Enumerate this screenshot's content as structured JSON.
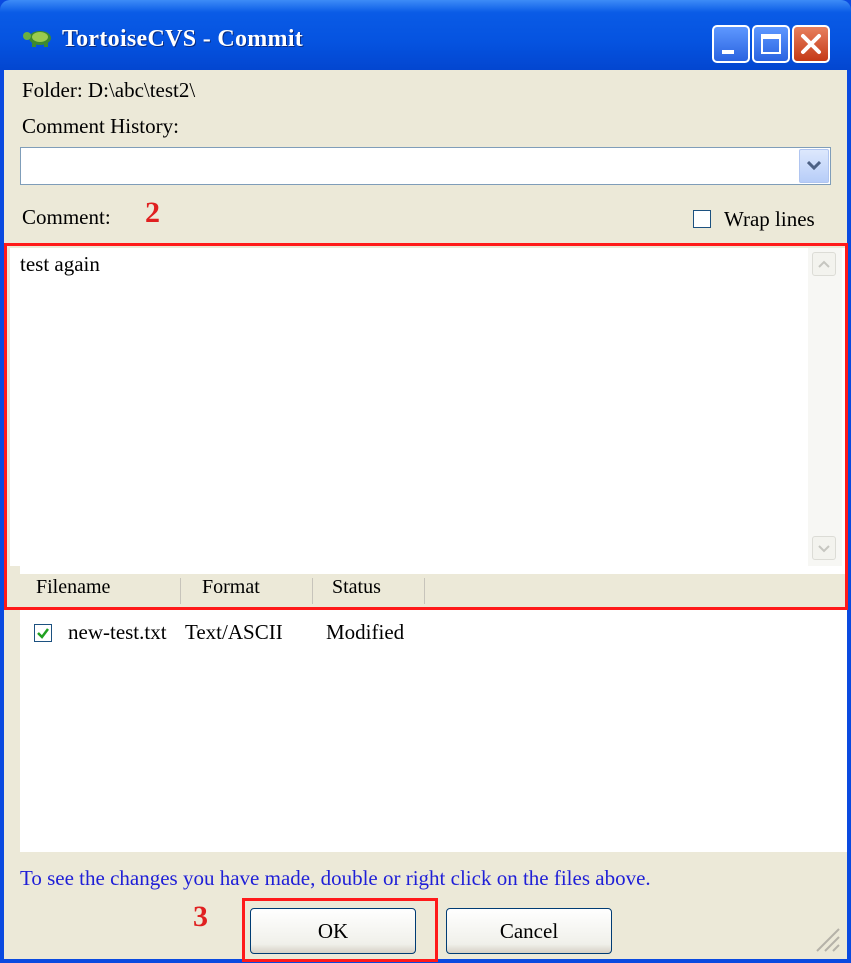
{
  "window": {
    "title": "TortoiseCVS - Commit",
    "icon": "tortoise-icon",
    "controls": [
      "minimize-icon",
      "maximize-icon",
      "close-icon"
    ]
  },
  "folder_label": "Folder: D:\\abc\\test2\\",
  "comment_history": {
    "label": "Comment History:",
    "value": ""
  },
  "comment": {
    "label": "Comment:",
    "text": "test again",
    "wrap_lines_label": "Wrap lines",
    "wrap_lines_checked": false
  },
  "files": {
    "columns": [
      "Filename",
      "Format",
      "Status"
    ],
    "rows": [
      {
        "checked": true,
        "filename": "new-test.txt",
        "format": "Text/ASCII",
        "status": "Modified"
      }
    ]
  },
  "hint": "To see the changes you have made, double or right click on the files above.",
  "buttons": {
    "ok": "OK",
    "cancel": "Cancel"
  },
  "annotations": {
    "step2": "2",
    "step3": "3"
  },
  "colors": {
    "annotation": "#ff1a1a",
    "title_bar": "#0553e0",
    "hint_text": "#1f1fd7"
  }
}
